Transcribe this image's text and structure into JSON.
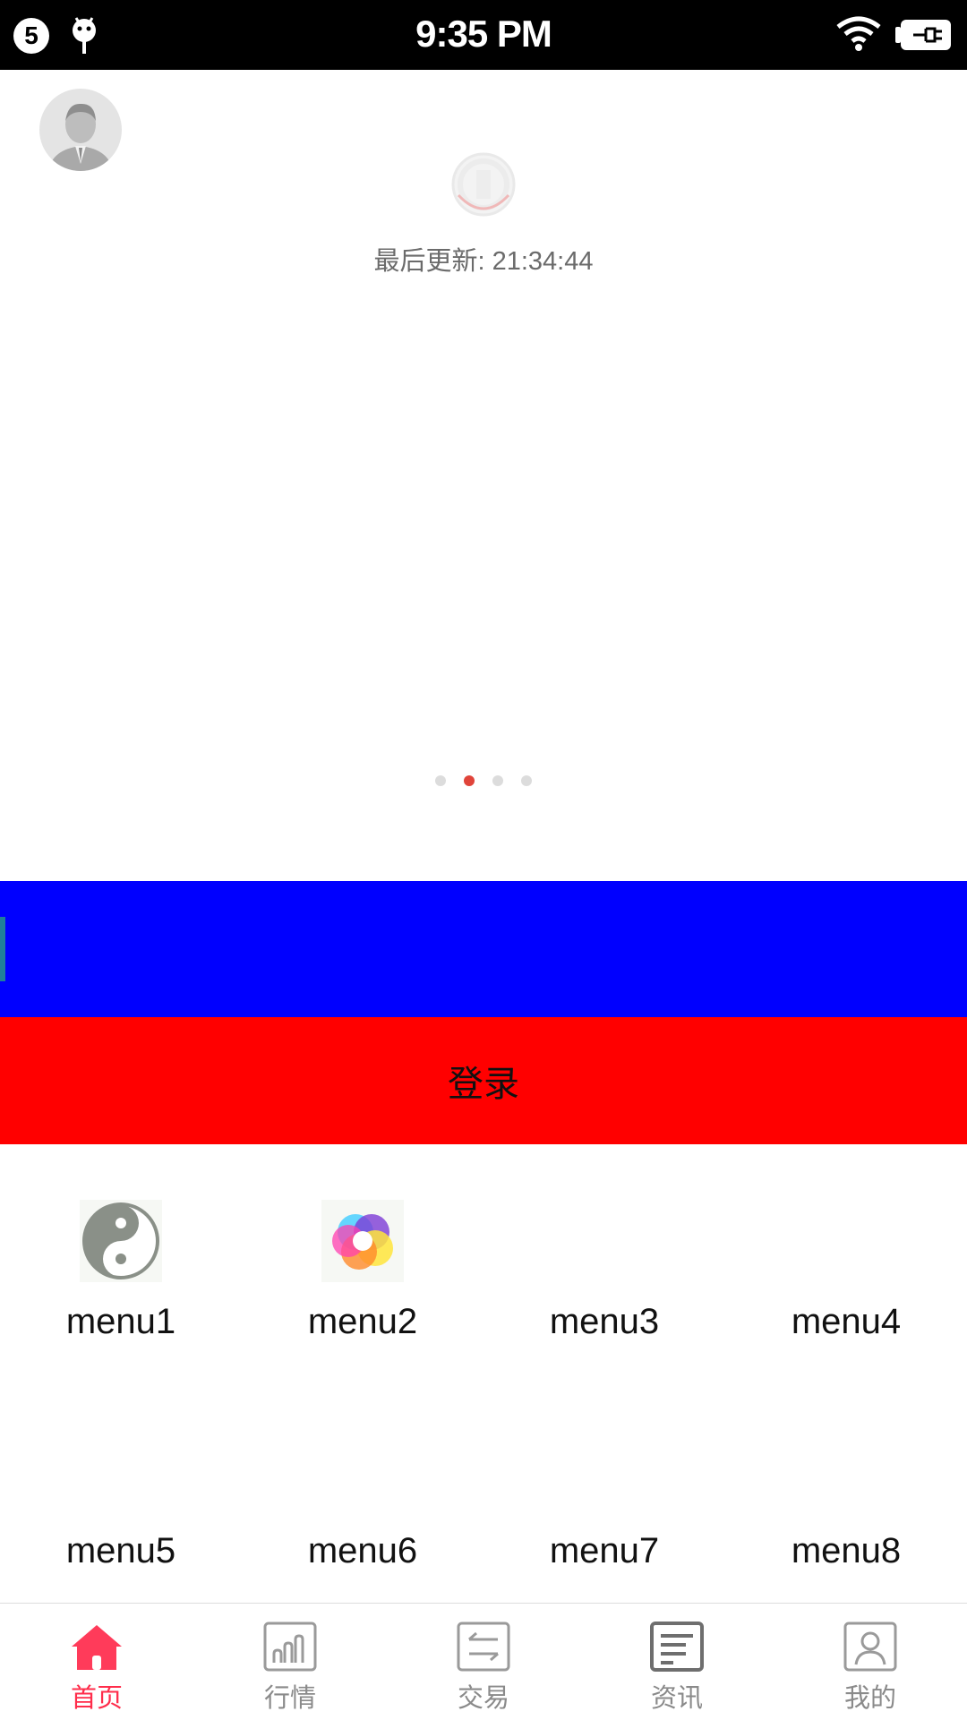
{
  "status_bar": {
    "notification_count": "5",
    "time": "9:35 PM"
  },
  "header": {
    "update_label": "最后更新:",
    "update_time": "21:34:44"
  },
  "carousel": {
    "dots": 4,
    "active_index": 1,
    "active_color": "#e0443a"
  },
  "input_bar": {
    "color": "#0000ff"
  },
  "login": {
    "label": "登录",
    "color": "#ff0000"
  },
  "menu": [
    {
      "label": "menu1",
      "icon": "yin-yang-icon"
    },
    {
      "label": "menu2",
      "icon": "rainbow-swirl-icon"
    },
    {
      "label": "menu3",
      "icon": ""
    },
    {
      "label": "menu4",
      "icon": ""
    },
    {
      "label": "menu5",
      "icon": ""
    },
    {
      "label": "menu6",
      "icon": ""
    },
    {
      "label": "menu7",
      "icon": ""
    },
    {
      "label": "menu8",
      "icon": ""
    }
  ],
  "tabbar": {
    "active_color": "#ff2d4b",
    "tabs": [
      {
        "label": "首页",
        "icon": "home-icon",
        "active": true
      },
      {
        "label": "行情",
        "icon": "market-chart-icon",
        "active": false
      },
      {
        "label": "交易",
        "icon": "exchange-arrows-icon",
        "active": false
      },
      {
        "label": "资讯",
        "icon": "news-document-icon",
        "active": false
      },
      {
        "label": "我的",
        "icon": "profile-icon",
        "active": false
      }
    ]
  }
}
